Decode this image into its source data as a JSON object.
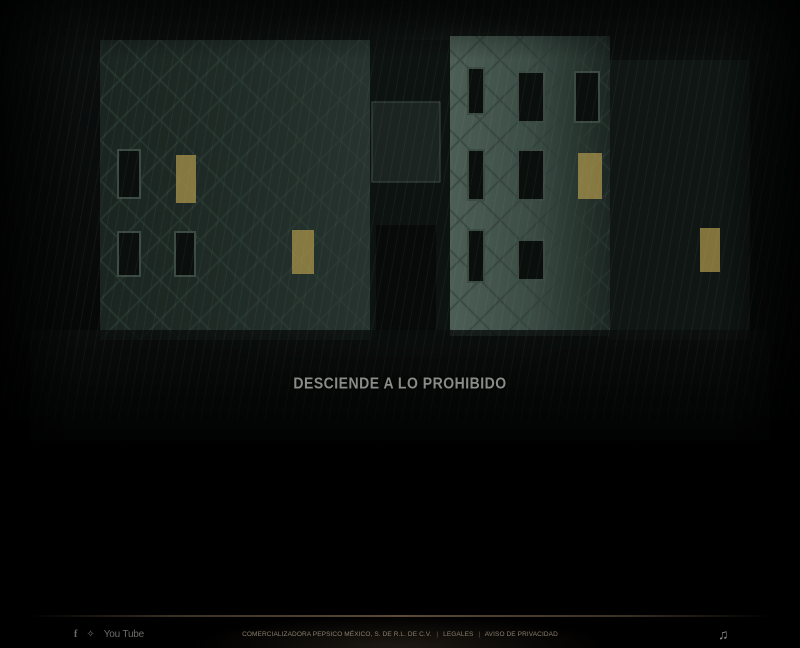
{
  "tagline": "DESCIENDE A LO PROHIBIDO",
  "footer": {
    "social": {
      "facebook_icon": "f",
      "twitter_icon": "✧",
      "youtube_label": "You Tube"
    },
    "legal": {
      "company": "COMERCIALIZADORA PEPSICO MÉXICO, S. DE R.L. DE C.V.",
      "separator": "|",
      "legales": "LEGALES",
      "privacy": "AVISO DE PRIVACIDAD"
    },
    "music_icon": "♫"
  },
  "colors": {
    "tagline": "#8a8c88",
    "window_light": "#b8a24a",
    "footer_text": "#8b7f6d"
  }
}
